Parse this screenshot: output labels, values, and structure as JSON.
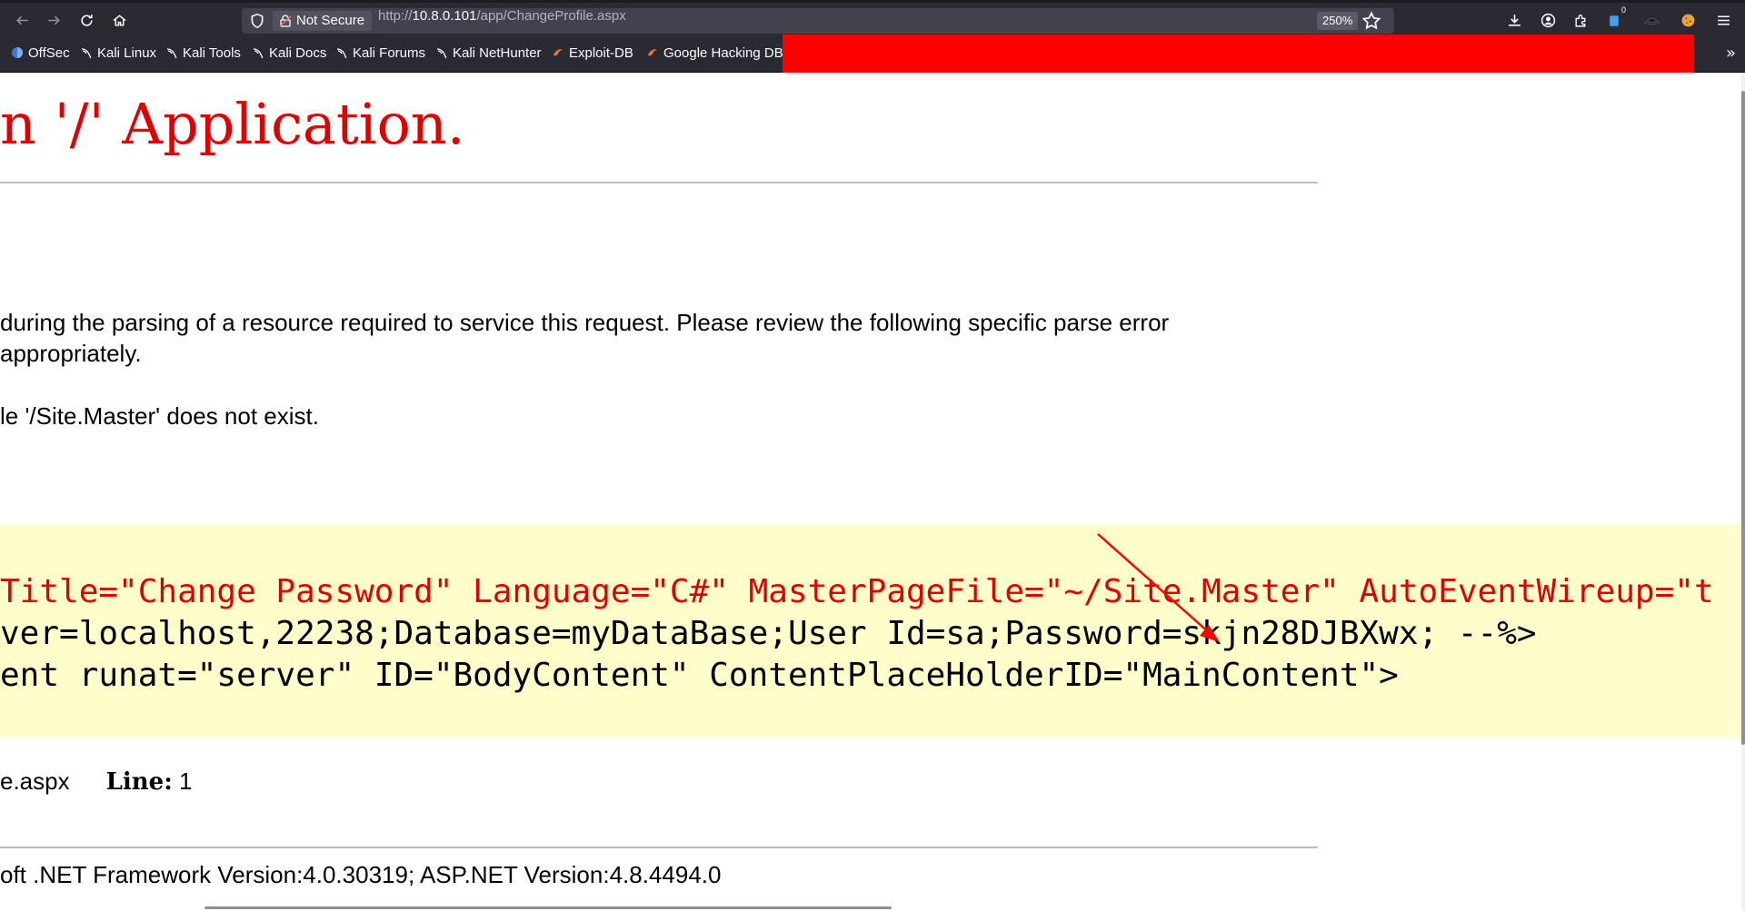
{
  "toolbar": {
    "not_secure_label": "Not Secure",
    "url_prefix": "http://",
    "url_host": "10.8.0.101",
    "url_path": "/app/ChangeProfile.aspx",
    "zoom_label": "250%",
    "extension_badge": "0"
  },
  "bookmarks": [
    {
      "label": "OffSec",
      "icon": "offsec-icon"
    },
    {
      "label": "Kali Linux",
      "icon": "kali-dragon-icon"
    },
    {
      "label": "Kali Tools",
      "icon": "kali-dragon-icon"
    },
    {
      "label": "Kali Docs",
      "icon": "kali-dragon-icon"
    },
    {
      "label": "Kali Forums",
      "icon": "kali-dragon-icon"
    },
    {
      "label": "Kali NetHunter",
      "icon": "kali-dragon-icon"
    },
    {
      "label": "Exploit-DB",
      "icon": "exploitdb-icon"
    },
    {
      "label": "Google Hacking DB",
      "icon": "exploitdb-icon"
    }
  ],
  "page": {
    "heading": "n '/' Application.",
    "description_line1": "during the parsing of a resource required to service this request. Please review the following specific parse error",
    "description_line2": "appropriately.",
    "parser_error_message": "le '/Site.Master' does not exist.",
    "code_line1": "Title=\"Change Password\" Language=\"C#\" MasterPageFile=\"~/Site.Master\" AutoEventWireup=\"t",
    "code_line2": "ver=localhost,22238;Database=myDataBase;User Id=sa;Password=skjn28DJBXwx; --%>",
    "code_line3": "ent runat=\"server\" ID=\"BodyContent\" ContentPlaceHolderID=\"MainContent\">",
    "source_file": "e.aspx",
    "line_label": "Line:",
    "line_value": "1",
    "version_info": "oft .NET Framework Version:4.0.30319; ASP.NET Version:4.8.4494.0"
  },
  "colors": {
    "error_red": "#e00000",
    "code_background": "#ffffcc",
    "redaction": "#ff0000",
    "toolbar_bg": "#2b2a33"
  }
}
